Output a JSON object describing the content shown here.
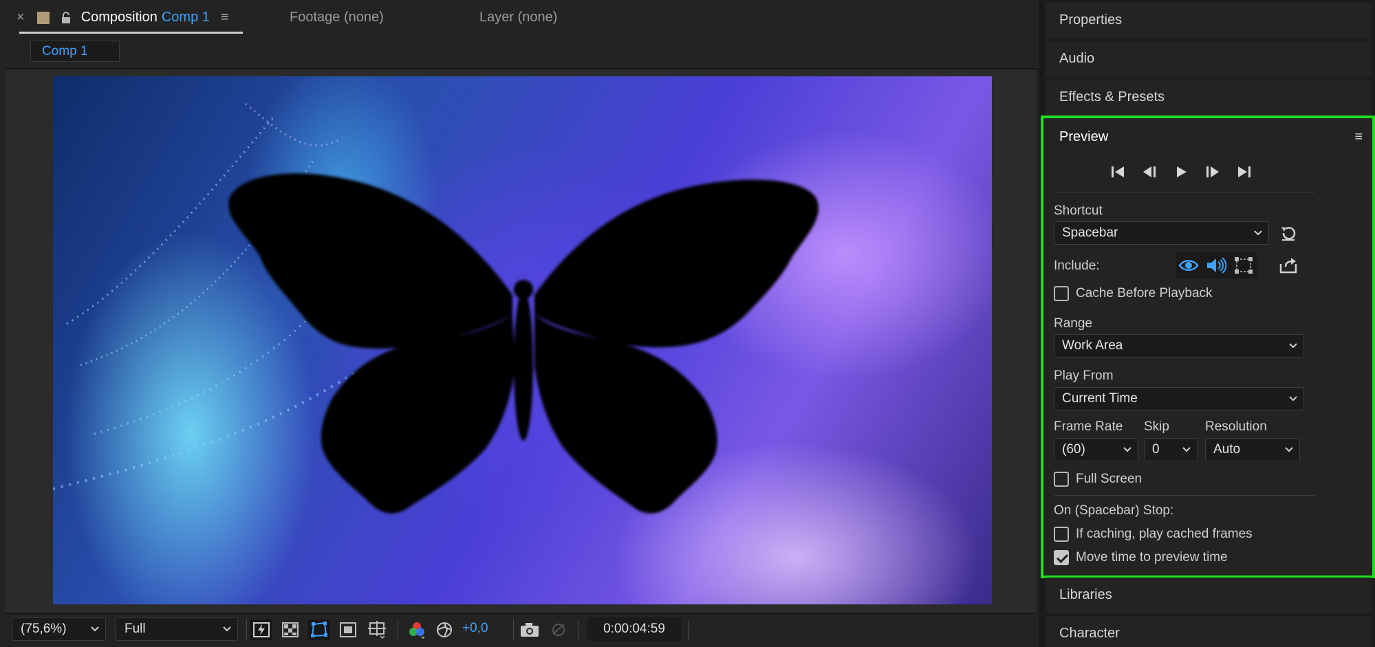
{
  "comp_panel": {
    "tab_label": "Composition",
    "comp_name": "Comp 1",
    "footage_tab": "Footage (none)",
    "layer_tab": "Layer (none)",
    "comp_chip": "Comp 1"
  },
  "viewer_toolbar": {
    "zoom": "(75,6%)",
    "resolution": "Full",
    "exposure": "+0,0",
    "timecode": "0:00:04:59"
  },
  "right_panels": {
    "properties": "Properties",
    "audio": "Audio",
    "effects": "Effects & Presets",
    "libraries": "Libraries",
    "character": "Character"
  },
  "preview": {
    "title": "Preview",
    "shortcut_label": "Shortcut",
    "shortcut_value": "Spacebar",
    "include_label": "Include:",
    "cache_before_playback": "Cache Before Playback",
    "range_label": "Range",
    "range_value": "Work Area",
    "play_from_label": "Play From",
    "play_from_value": "Current Time",
    "frame_rate_label": "Frame Rate",
    "frame_rate_value": "(60)",
    "skip_label": "Skip",
    "skip_value": "0",
    "resolution_label": "Resolution",
    "resolution_value": "Auto",
    "full_screen": "Full Screen",
    "on_stop_label": "On (Spacebar) Stop:",
    "if_caching": "If caching, play cached frames",
    "move_time": "Move time to preview time",
    "cache_checked": false,
    "full_screen_checked": false,
    "if_caching_checked": false,
    "move_time_checked": true
  },
  "colors": {
    "accent_blue": "#3fa1ff",
    "highlight_green": "#1ee01e",
    "panel_bg": "#232323"
  }
}
